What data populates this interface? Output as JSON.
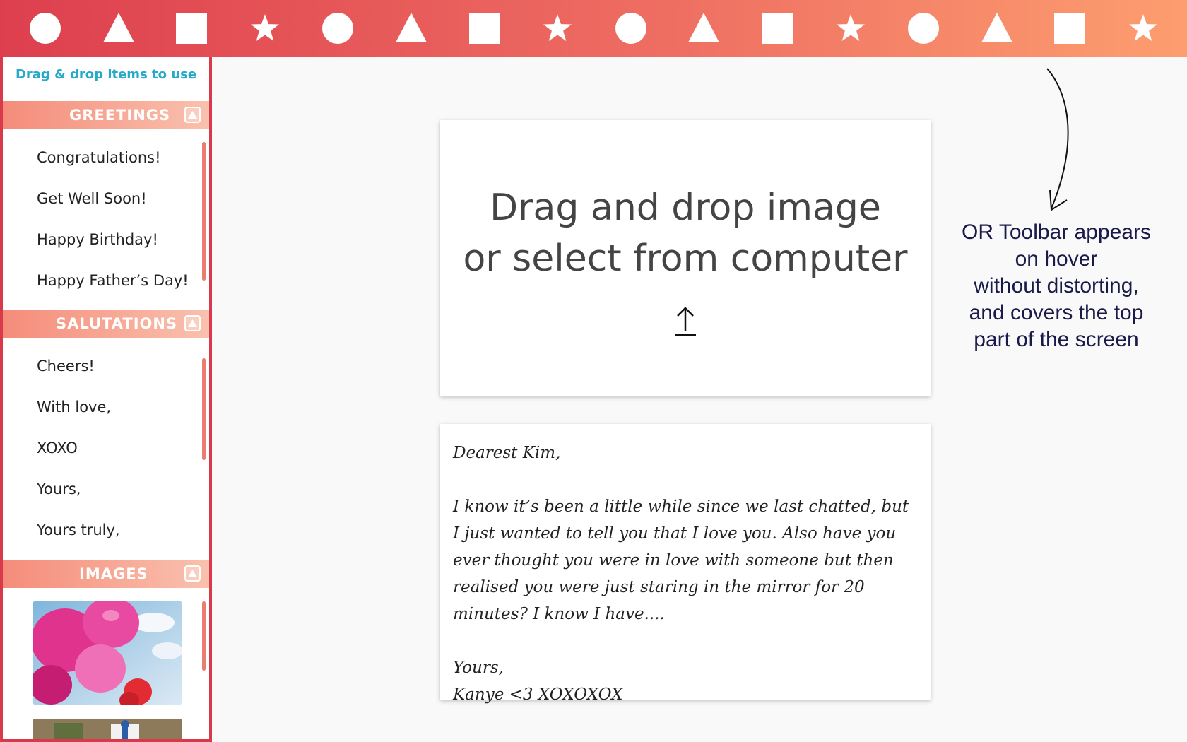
{
  "toolbar": {
    "shapes": [
      {
        "icon": "circle-icon"
      },
      {
        "icon": "triangle-icon"
      },
      {
        "icon": "square-icon"
      },
      {
        "icon": "star-icon"
      },
      {
        "icon": "circle-icon"
      },
      {
        "icon": "triangle-icon"
      },
      {
        "icon": "square-icon"
      },
      {
        "icon": "star-icon"
      },
      {
        "icon": "circle-icon"
      },
      {
        "icon": "triangle-icon"
      },
      {
        "icon": "square-icon"
      },
      {
        "icon": "star-icon"
      },
      {
        "icon": "circle-icon"
      },
      {
        "icon": "triangle-icon"
      },
      {
        "icon": "square-icon"
      },
      {
        "icon": "star-icon"
      }
    ],
    "gradient_start": "#dd3f4e",
    "gradient_end": "#fd9e6f"
  },
  "sidebar": {
    "hint": "Drag & drop items to use",
    "accent": "#d83a4c",
    "sections": {
      "greetings": {
        "title": "GREETINGS",
        "items": [
          "Congratulations!",
          "Get Well Soon!",
          "Happy Birthday!",
          "Happy Father’s Day!"
        ]
      },
      "salutations": {
        "title": "SALUTATIONS",
        "items": [
          "Cheers!",
          "With love,",
          "XOXO",
          "Yours,",
          "Yours truly,"
        ]
      },
      "images": {
        "title": "IMAGES",
        "items": [
          "pink-balloons-image",
          "gift-box-image"
        ]
      }
    }
  },
  "upload": {
    "line1": "Drag and drop image",
    "line2": "or select from computer",
    "icon": "upload-arrow-icon"
  },
  "letter": {
    "greeting": "Dearest Kim,",
    "body": "I know it’s been a little while since we last chatted, but I just wanted to tell you that I love you. Also have you ever thought you were in love with someone but then realised you were just staring in the mirror for 20 minutes? I know I have....",
    "closing": "Yours,",
    "signature": "Kanye <3 XOXOXOX"
  },
  "annotation": {
    "lines": [
      "OR Toolbar appears",
      "on hover",
      "without distorting,",
      "and covers the top",
      "part of the screen"
    ]
  }
}
